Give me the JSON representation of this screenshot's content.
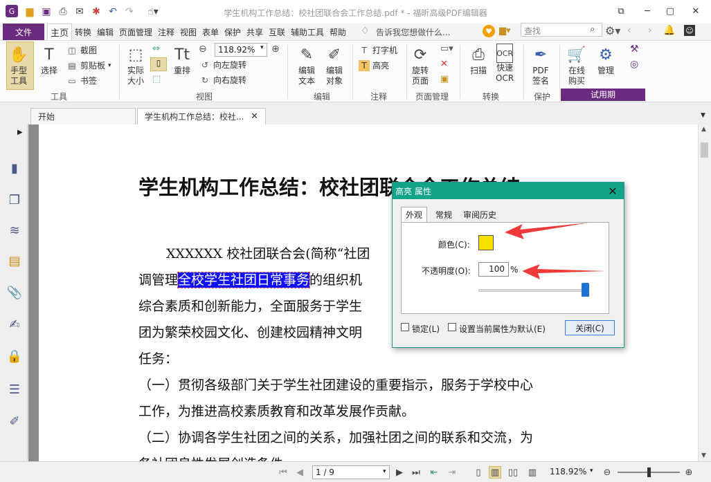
{
  "window": {
    "title": "学生机构工作总结：校社团联合会工作总结.pdf * - 福昕高级PDF编辑器"
  },
  "menu": {
    "file": "文件",
    "tabs": [
      "主页",
      "转换",
      "编辑",
      "页面管理",
      "注释",
      "视图",
      "表单",
      "保护",
      "共享",
      "互联",
      "辅助工具",
      "帮助"
    ],
    "tell_me": "告诉我您想做什么...",
    "search_placeholder": "查找"
  },
  "ribbon": {
    "tools": {
      "hand": "手型\n工具",
      "select": "选择",
      "screenshot": "截图",
      "clipboard": "剪贴板",
      "bookmark": "书签",
      "label": "工具"
    },
    "view": {
      "actual_size": "实际\n大小",
      "reflow": "重排",
      "zoom": "118.92%",
      "rotate_left": "向左旋转",
      "rotate_right": "向右旋转",
      "label": "视图"
    },
    "edit": {
      "edit_text": "编辑\n文本",
      "edit_object": "编辑\n对象",
      "label": "编辑"
    },
    "annot": {
      "typewriter": "打字机",
      "highlight": "高亮",
      "label": "注释"
    },
    "pages": {
      "rotate_page": "旋转\n页面",
      "label": "页面管理"
    },
    "convert": {
      "scan": "扫描",
      "ocr": "快速\nOCR",
      "label": "转换"
    },
    "protect": {
      "pdf_sign": "PDF\n签名",
      "label": "保护"
    },
    "trial": {
      "buy": "在线\n购买",
      "manage": "管理",
      "label": "试用期"
    }
  },
  "tabs": {
    "start": "开始",
    "document": "学生机构工作总结：校社..."
  },
  "document": {
    "heading": "学生机构工作总结：校社团联合会工作总结",
    "p1": "XXXXXX 校社团联合会(简称“社团",
    "p2_pre": "调管理",
    "p2_hl": "全校学生社团日常事务",
    "p2_post": "的组织机",
    "p3": "综合素质和创新能力，全面服务于学生",
    "p4": "团为繁荣校园文化、创建校园精神文明",
    "p5": "任务：",
    "p6": "（一）贯彻各级部门关于学生社团建设的重要指示，服务于学校中心",
    "p7": "工作，为推进高校素质教育和改革发展作贡献。",
    "p8": "（二）协调各学生社团之间的关系，加强社团之间的联系和交流，为",
    "p9": "各社团良性发展创造条件"
  },
  "dialog": {
    "title": "高亮 属性",
    "tabs": [
      "外观",
      "常规",
      "审阅历史"
    ],
    "color_label": "颜色(C):",
    "color_value": "#f8e000",
    "opacity_label": "不透明度(O):",
    "opacity_value": "100",
    "opacity_unit": "%",
    "opacity_level": 1.0,
    "lock_label": "锁定(L)",
    "default_label": "设置当前属性为默认(E)",
    "close_button": "关闭(C)"
  },
  "statusbar": {
    "page": "1 / 9",
    "zoom": "118.92%"
  },
  "colors": {
    "accent_purple": "#6a2a7d",
    "dialog_teal": "#12a389",
    "highlight_blue": "#1010ff",
    "arrow_red": "#f03a3a"
  }
}
